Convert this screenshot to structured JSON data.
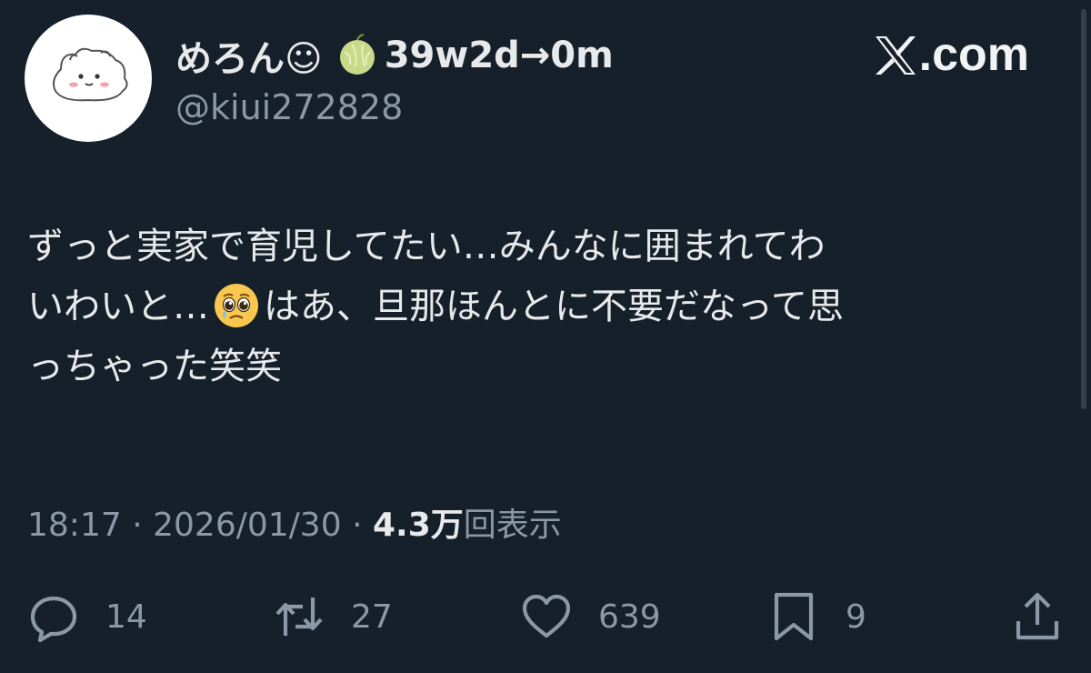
{
  "author": {
    "display_name_prefix": "めろん☺",
    "display_name_suffix": "39w2d→0m",
    "melon_icon": "melon-emoji",
    "handle": "@kiui272828",
    "avatar": "white-cartoon-mascot"
  },
  "brand": {
    "logo_icon": "x-logo",
    "text": ".com"
  },
  "tweet": {
    "line1": "ずっと実家で育児してたい…みんなに囲まれてわ",
    "line2_before_emoji": "いわいと…",
    "emoji": "pleading-face-emoji",
    "line2_after_emoji": "はあ、旦那ほんとに不要だなって思",
    "line3": "っちゃった笑笑"
  },
  "meta": {
    "time": "18:17",
    "separator": "·",
    "date": "2026/01/30",
    "views_count": "4.3万",
    "views_label": "回表示"
  },
  "actions": {
    "replies": "14",
    "retweets": "27",
    "likes": "639",
    "bookmarks": "9"
  },
  "colors": {
    "background": "#15202b",
    "primary_text": "#e7e9ea",
    "secondary_text": "#8b98a5"
  }
}
